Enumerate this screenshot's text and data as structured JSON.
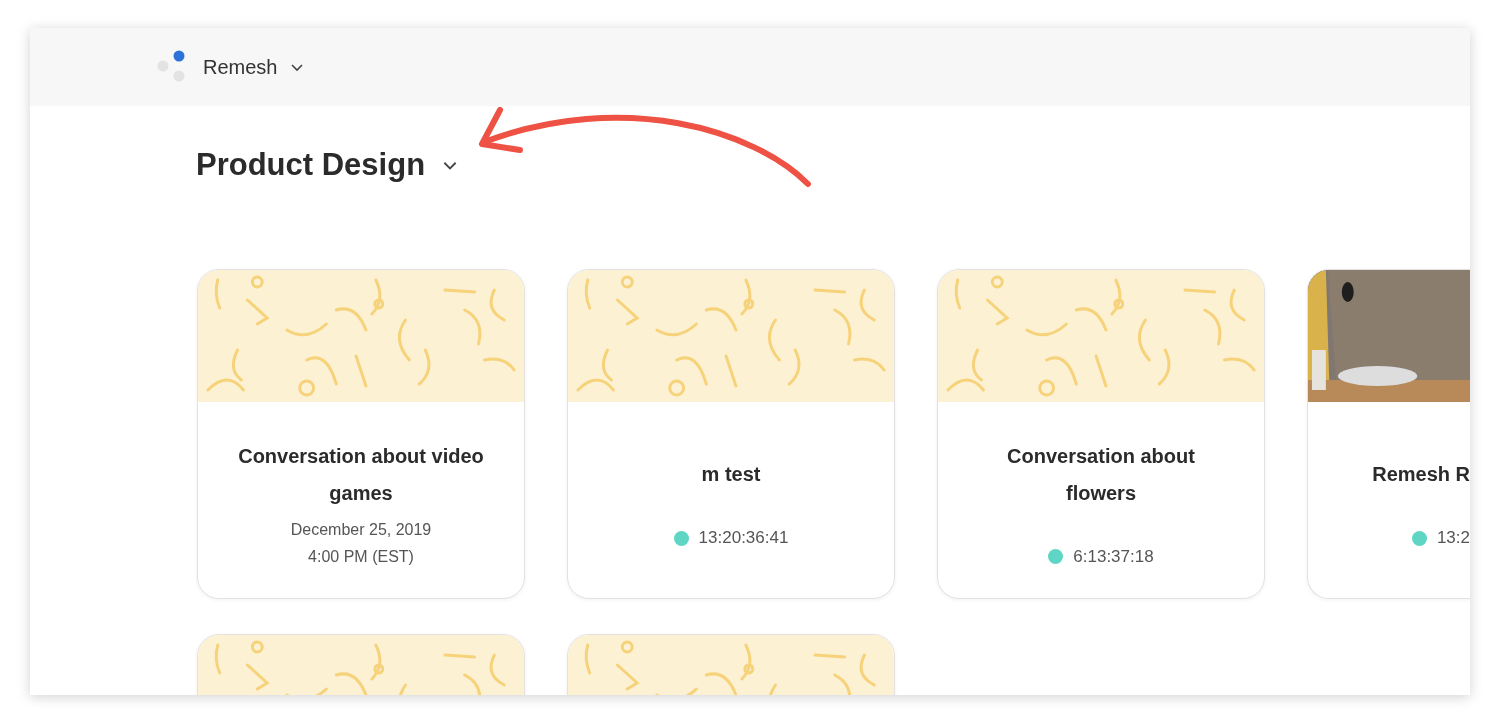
{
  "header": {
    "workspace": "Remesh"
  },
  "page": {
    "title": "Product Design"
  },
  "cards": [
    {
      "kind": "scheduled",
      "title": "Conversation about video games",
      "date": "December 25, 2019",
      "time": "4:00 PM (EST)"
    },
    {
      "kind": "live",
      "title": "m test",
      "timer": "13:20:36:41"
    },
    {
      "kind": "live",
      "title": "Conversation about flowers",
      "timer": "6:13:37:18"
    },
    {
      "kind": "live",
      "title": "Remesh R",
      "timer": "13:2",
      "cut": true
    },
    {
      "kind": "preview"
    },
    {
      "kind": "preview"
    }
  ]
}
